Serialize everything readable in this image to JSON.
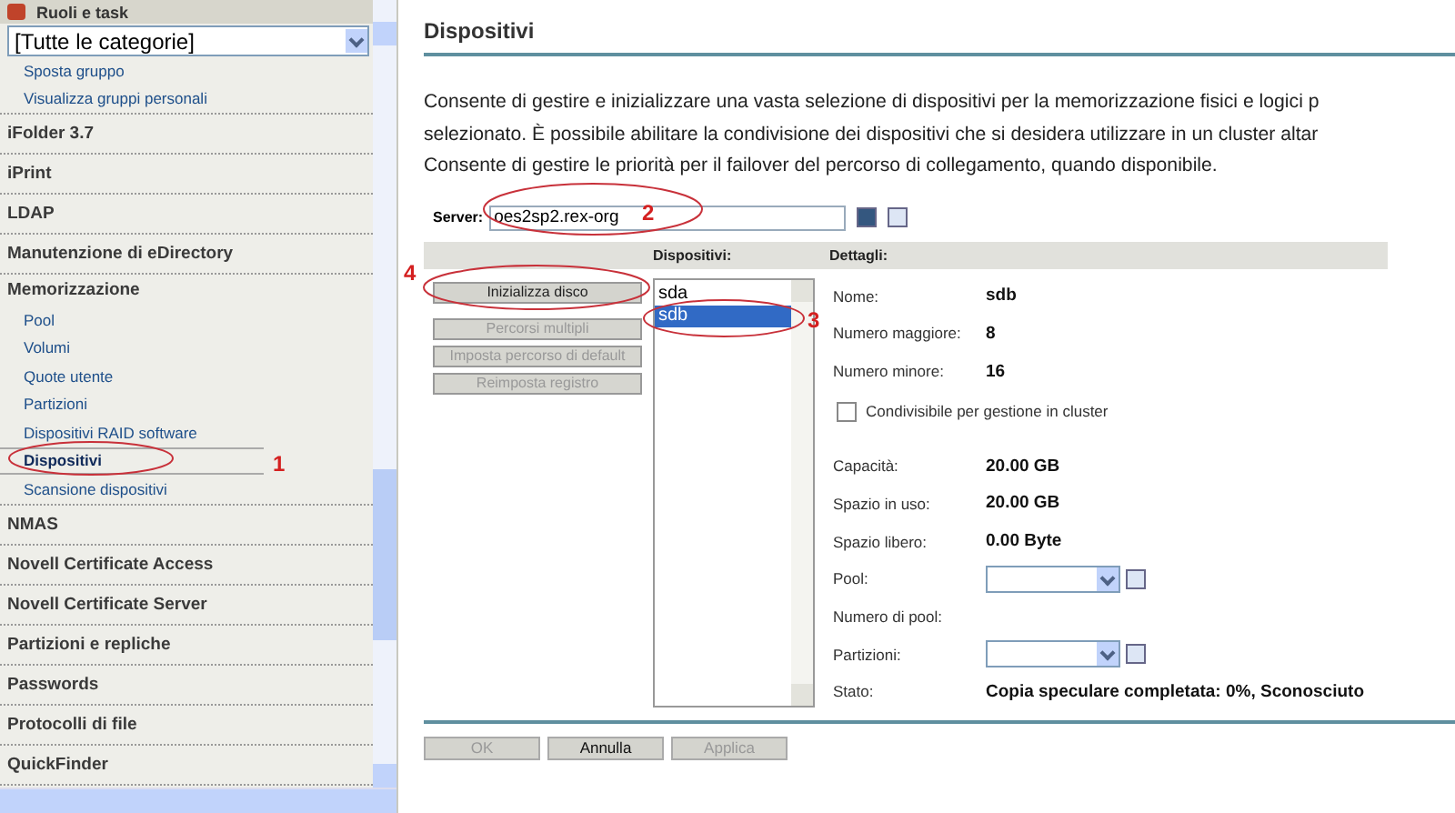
{
  "sidebar": {
    "header": "Ruoli e task",
    "category_select": "[Tutte le categorie]",
    "groups": [
      {
        "children": [
          {
            "label": "Sposta gruppo",
            "selected": false
          },
          {
            "label": "Visualizza gruppi personali",
            "selected": false
          }
        ]
      },
      {
        "label": "iFolder 3.7"
      },
      {
        "label": "iPrint"
      },
      {
        "label": "LDAP"
      },
      {
        "label": "Manutenzione di eDirectory"
      },
      {
        "label": "Memorizzazione",
        "children": [
          {
            "label": "Pool",
            "selected": false
          },
          {
            "label": "Volumi",
            "selected": false
          },
          {
            "label": "Quote utente",
            "selected": false
          },
          {
            "label": "Partizioni",
            "selected": false
          },
          {
            "label": "Dispositivi RAID software",
            "selected": false
          },
          {
            "label": "Dispositivi",
            "selected": true
          },
          {
            "label": "Scansione dispositivi",
            "selected": false
          }
        ]
      },
      {
        "label": "NMAS"
      },
      {
        "label": "Novell Certificate Access"
      },
      {
        "label": "Novell Certificate Server"
      },
      {
        "label": "Partizioni e repliche"
      },
      {
        "label": "Passwords"
      },
      {
        "label": "Protocolli di file"
      },
      {
        "label": "QuickFinder"
      }
    ]
  },
  "page": {
    "title": "Dispositivi",
    "description_lines": [
      "Consente di gestire e inizializzare una vasta selezione di dispositivi per la memorizzazione fisici e logici p",
      "selezionato. È possibile abilitare la condivisione dei dispositivi che si desidera utilizzare in un cluster altar",
      "Consente di gestire le priorità per il failover del percorso di collegamento, quando disponibile."
    ],
    "server": {
      "label": "Server:",
      "value": "oes2sp2.rex-org"
    },
    "columns": [
      "Dispositivi:",
      "Dettagli:"
    ],
    "actions": [
      {
        "label": "Inizializza disco",
        "disabled": false
      },
      {
        "label": "Percorsi multipli",
        "disabled": true
      },
      {
        "label": "Imposta percorso di default",
        "disabled": true
      },
      {
        "label": "Reimposta registro",
        "disabled": true
      }
    ],
    "devices": [
      {
        "label": "sda",
        "selected": false
      },
      {
        "label": "sdb",
        "selected": true
      }
    ],
    "details": [
      {
        "kind": "text",
        "label": "Nome:",
        "value": "sdb"
      },
      {
        "kind": "text",
        "label": "Numero maggiore:",
        "value": "8"
      },
      {
        "kind": "text",
        "label": "Numero minore:",
        "value": "16"
      },
      {
        "kind": "checkbox",
        "label": "Condivisibile per gestione in cluster",
        "checked": false
      },
      {
        "kind": "text",
        "label": "Capacità:",
        "value": "20.00 GB"
      },
      {
        "kind": "text",
        "label": "Spazio in uso:",
        "value": "20.00 GB"
      },
      {
        "kind": "text",
        "label": "Spazio libero:",
        "value": "0.00 Byte"
      },
      {
        "kind": "select",
        "label": "Pool:"
      },
      {
        "kind": "text",
        "label": "Numero di pool:"
      },
      {
        "kind": "select",
        "label": "Partizioni:"
      },
      {
        "kind": "text",
        "label": "Stato:",
        "value": "Copia speculare completata: 0%, Sconosciuto"
      }
    ],
    "buttons": [
      {
        "label": "OK",
        "disabled": true
      },
      {
        "label": "Annulla",
        "disabled": false
      },
      {
        "label": "Applica",
        "disabled": true
      }
    ]
  },
  "annotations": [
    {
      "number": "1"
    },
    {
      "number": "2"
    },
    {
      "number": "3"
    },
    {
      "number": "4"
    }
  ]
}
